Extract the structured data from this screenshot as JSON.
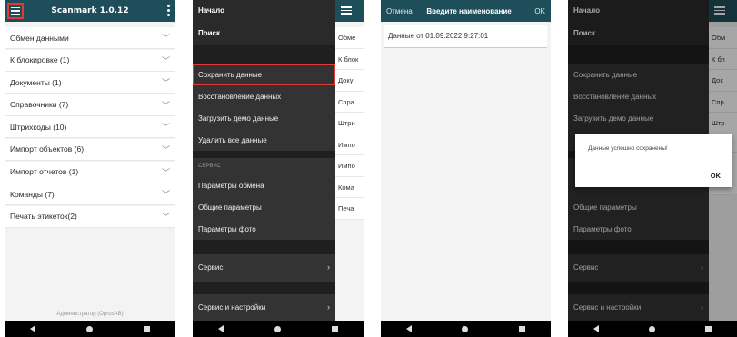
{
  "screen1": {
    "title": "Scanmark 1.0.12",
    "items": [
      "Обмен данными",
      "К блокировке (1)",
      "Документы (1)",
      "Справочники (7)",
      "Штрихкоды (10)",
      "Импорт объектов (6)",
      "Импорт отчетов (1)",
      "Команды (7)",
      "Печать этикеток(2)"
    ],
    "footer": "Администратор (OprosAB)"
  },
  "drawer": {
    "header": "Начало",
    "search": "Поиск",
    "items_top": [
      "Сохранить данные",
      "Восстановление данных",
      "Загрузить демо данные",
      "Удалить все данные"
    ],
    "section": "СЕРВИС",
    "items_service": [
      "Параметры обмена",
      "Общие параметры",
      "Параметры фото"
    ],
    "ext1": "Сервис",
    "ext2": "Сервис и настройки"
  },
  "bg_items": [
    "Обме",
    "К блок",
    "Доку",
    "Спра",
    "Штри",
    "Импо",
    "Импо",
    "Кома",
    "Печа"
  ],
  "screen3": {
    "cancel": "Отмена",
    "title": "Введите наименование",
    "ok": "OK",
    "value": "Данные от 01.09.2022 9:27:01"
  },
  "screen4": {
    "dialog_message": "Данные успешно сохранены!",
    "dialog_ok": "OK",
    "bg_items": [
      "Обм",
      "К бл",
      "Док",
      "Спр",
      "Штр",
      "Ком",
      "Печ"
    ]
  }
}
